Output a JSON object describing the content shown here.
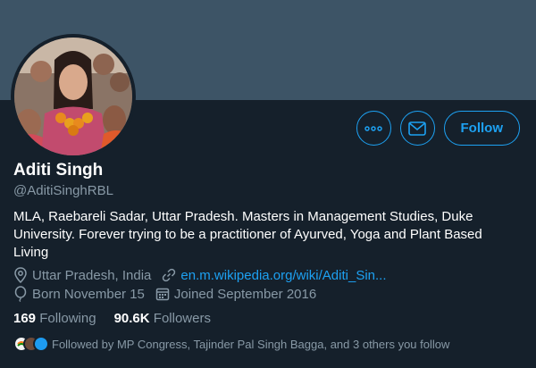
{
  "profile": {
    "name": "Aditi Singh",
    "handle": "@AditiSinghRBL",
    "bio": "MLA, Raebareli Sadar, Uttar Pradesh. Masters in Management Studies, Duke University. Forever trying to be a practitioner of Ayurved, Yoga and Plant Based Living",
    "location": "Uttar Pradesh, India",
    "website": "en.m.wikipedia.org/wiki/Aditi_Sin...",
    "birthday": "Born November 15",
    "joined": "Joined September 2016"
  },
  "stats": {
    "following_count": "169",
    "following_label": "Following",
    "followers_count": "90.6K",
    "followers_label": "Followers"
  },
  "actions": {
    "follow_label": "Follow"
  },
  "followed_by": "Followed by MP Congress, Tajinder Pal Singh Bagga, and 3 others you follow",
  "colors": {
    "background": "#15202b",
    "banner": "#3d5466",
    "accent": "#1da1f2",
    "secondary_text": "#8899a6"
  }
}
